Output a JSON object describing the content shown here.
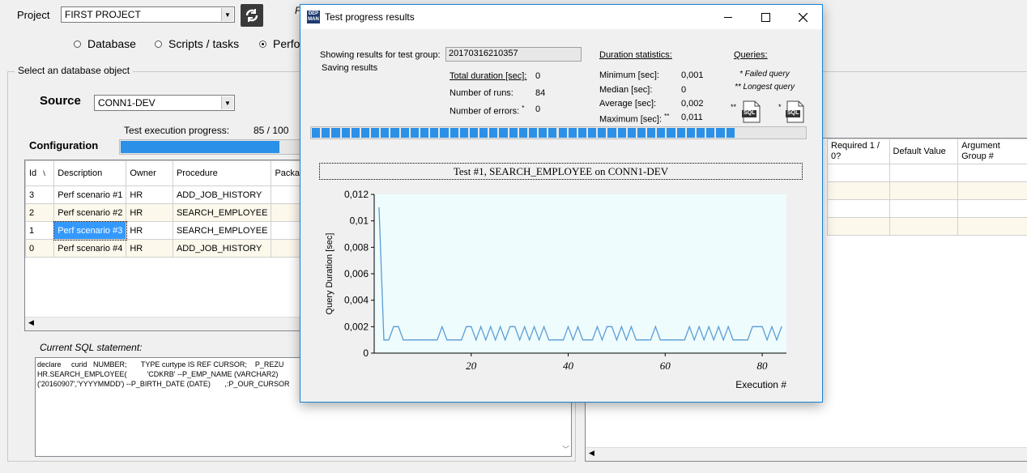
{
  "main": {
    "project_label": "Project",
    "project_value": "FIRST PROJECT",
    "radios": [
      {
        "label": "Database",
        "selected": false
      },
      {
        "label": "Scripts / tasks",
        "selected": false
      },
      {
        "label": "Perfo",
        "selected": true
      }
    ],
    "select_db_object_label": "Select an database object",
    "source_label": "Source",
    "source_value": "CONN1-DEV",
    "progress_label": "Test execution progress:",
    "progress_text": "85 / 100",
    "progress_fraction": 0.85,
    "configuration_label": "Configuration",
    "table": {
      "headers": [
        "Id",
        "Description",
        "Owner",
        "Procedure",
        "Packa"
      ],
      "rows": [
        [
          "3",
          "Perf scenario #1",
          "HR",
          "ADD_JOB_HISTORY",
          ""
        ],
        [
          "2",
          "Perf scenario #2",
          "HR",
          "SEARCH_EMPLOYEE",
          ""
        ],
        [
          "1",
          "Perf scenario #3",
          "HR",
          "SEARCH_EMPLOYEE",
          ""
        ],
        [
          "0",
          "Perf scenario #4",
          "HR",
          "ADD_JOB_HISTORY",
          ""
        ]
      ]
    },
    "sql_label": "Current SQL statement:",
    "sql_text": [
      "declare     curid   NUMBER;       TYPE curtype IS REF CURSOR;    P_REZU",
      "HR.SEARCH_EMPLOYEE(          'CDKRB' --P_EMP_NAME (VARCHAR2)",
      "('20160907','YYYYMMDD') --P_BIRTH_DATE (DATE)       ,:P_OUR_CURSOR"
    ],
    "args_table": {
      "headers": [
        "Required 1 / 0?",
        "Default Value",
        "Argument Group #"
      ]
    },
    "partial_top_label": "F"
  },
  "dialog": {
    "title": "Test progress results",
    "icon_text": "DEP MAN",
    "showing_label": "Showing results for test group:",
    "group_id": "20170316210357",
    "saving_text": "Saving results",
    "total_duration_label": "Total duration [sec]:",
    "total_duration_value": "0",
    "runs_label": "Number of runs:",
    "runs_value": "84",
    "errors_label": "Number of errors:",
    "errors_marker": "*",
    "errors_value": "0",
    "duration_stats_label": "Duration statistics:",
    "min_label": "Minimum [sec]:",
    "min_value": "0,001",
    "median_label": "Median [sec]:",
    "median_value": "0",
    "avg_label": "Average [sec]:",
    "avg_value": "0,002",
    "max_label": "Maximum [sec]:",
    "max_marker": "**",
    "max_value": "0,011",
    "queries_label": "Queries:",
    "failed_query_label": "* Failed query",
    "longest_query_label": "** Longest query",
    "sql_icon_label": "SQL",
    "sql_marker_longest": "**",
    "sql_marker_failed": "*",
    "progress_segments": 43,
    "progress_total_segments": 50,
    "colors": {
      "plot_bg": "#eefcfd",
      "line": "#5b9bd5",
      "progress": "#2b90e8"
    }
  },
  "chart_data": {
    "type": "line",
    "title": "Test #1, SEARCH_EMPLOYEE on CONN1-DEV",
    "xlabel": "Execution #",
    "ylabel": "Query Duration [sec]",
    "xlim": [
      0,
      85
    ],
    "ylim": [
      0,
      0.012
    ],
    "xticks": [
      20,
      40,
      60,
      80
    ],
    "yticks": [
      0,
      0.002,
      0.004,
      0.006,
      0.008,
      0.01,
      0.012
    ],
    "ytick_labels": [
      "0",
      "0,002",
      "0,004",
      "0,006",
      "0,008",
      "0,01",
      "0,012"
    ],
    "grid": false,
    "x": [
      1,
      2,
      3,
      4,
      5,
      6,
      7,
      8,
      9,
      10,
      11,
      12,
      13,
      14,
      15,
      16,
      17,
      18,
      19,
      20,
      21,
      22,
      23,
      24,
      25,
      26,
      27,
      28,
      29,
      30,
      31,
      32,
      33,
      34,
      35,
      36,
      37,
      38,
      39,
      40,
      41,
      42,
      43,
      44,
      45,
      46,
      47,
      48,
      49,
      50,
      51,
      52,
      53,
      54,
      55,
      56,
      57,
      58,
      59,
      60,
      61,
      62,
      63,
      64,
      65,
      66,
      67,
      68,
      69,
      70,
      71,
      72,
      73,
      74,
      75,
      76,
      77,
      78,
      79,
      80,
      81,
      82,
      83,
      84
    ],
    "y": [
      0.011,
      0.001,
      0.001,
      0.002,
      0.002,
      0.001,
      0.001,
      0.001,
      0.001,
      0.001,
      0.001,
      0.001,
      0.001,
      0.002,
      0.001,
      0.001,
      0.001,
      0.001,
      0.002,
      0.002,
      0.001,
      0.002,
      0.001,
      0.002,
      0.001,
      0.002,
      0.001,
      0.002,
      0.002,
      0.001,
      0.002,
      0.001,
      0.002,
      0.001,
      0.002,
      0.001,
      0.001,
      0.001,
      0.001,
      0.002,
      0.001,
      0.002,
      0.001,
      0.001,
      0.001,
      0.002,
      0.001,
      0.002,
      0.002,
      0.001,
      0.002,
      0.001,
      0.002,
      0.001,
      0.001,
      0.001,
      0.001,
      0.002,
      0.001,
      0.001,
      0.001,
      0.001,
      0.001,
      0.001,
      0.002,
      0.001,
      0.002,
      0.001,
      0.002,
      0.001,
      0.002,
      0.001,
      0.002,
      0.001,
      0.001,
      0.001,
      0.001,
      0.002,
      0.002,
      0.002,
      0.001,
      0.002,
      0.001,
      0.002
    ]
  }
}
